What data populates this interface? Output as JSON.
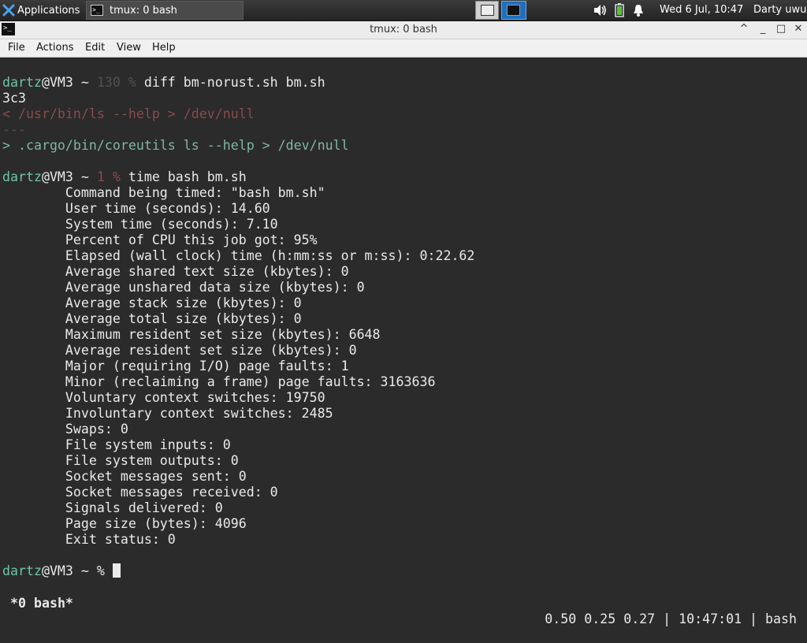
{
  "panel": {
    "apps_label": "Applications",
    "task_label": "tmux: 0 bash",
    "clock": "Wed  6 Jul, 10:47",
    "user": "Darty uwu",
    "icons": [
      "xfce-logo-icon",
      "terminal-icon",
      "volume-icon",
      "battery-icon",
      "notification-bell-icon"
    ]
  },
  "window": {
    "title": "tmux: 0 bash",
    "buttons": [
      "^",
      "_",
      "□",
      "✕"
    ]
  },
  "menu": [
    "File",
    "Actions",
    "Edit",
    "View",
    "Help"
  ],
  "terminal": {
    "cmd1": {
      "user": "dartz",
      "host": "@VM3 ~ ",
      "code": "130 %",
      "cmd": " diff bm-norust.sh bm.sh"
    },
    "diff": {
      "hunk": "3c3",
      "minus": "< /usr/bin/ls --help > /dev/null",
      "sep": "---",
      "plus": "> .cargo/bin/coreutils ls --help > /dev/null"
    },
    "cmd2": {
      "user": "dartz",
      "host": "@VM3 ~ ",
      "code": "1 %",
      "cmd": " time bash bm.sh"
    },
    "output": [
      "        Command being timed: \"bash bm.sh\"",
      "        User time (seconds): 14.60",
      "        System time (seconds): 7.10",
      "        Percent of CPU this job got: 95%",
      "        Elapsed (wall clock) time (h:mm:ss or m:ss): 0:22.62",
      "        Average shared text size (kbytes): 0",
      "        Average unshared data size (kbytes): 0",
      "        Average stack size (kbytes): 0",
      "        Average total size (kbytes): 0",
      "        Maximum resident set size (kbytes): 6648",
      "        Average resident set size (kbytes): 0",
      "        Major (requiring I/O) page faults: 1",
      "        Minor (reclaiming a frame) page faults: 3163636",
      "        Voluntary context switches: 19750",
      "        Involuntary context switches: 2485",
      "        Swaps: 0",
      "        File system inputs: 0",
      "        File system outputs: 0",
      "        Socket messages sent: 0",
      "        Socket messages received: 0",
      "        Signals delivered: 0",
      "        Page size (bytes): 4096",
      "        Exit status: 0"
    ],
    "prompt3": {
      "user": "dartz",
      "host": "@VM3 ~ ",
      "code": "%",
      "after": " "
    }
  },
  "status": {
    "left": "*0 bash*",
    "right": "0.50 0.25 0.27 | 10:47:01 | bash"
  },
  "colors": {
    "terminal_bg": "#2b2b2b",
    "prompt": "#6ec5a8",
    "diff_minus": "#8a4b4b",
    "diff_plus": "#7fb7a0",
    "workspace_active": "#1f6fbf"
  }
}
